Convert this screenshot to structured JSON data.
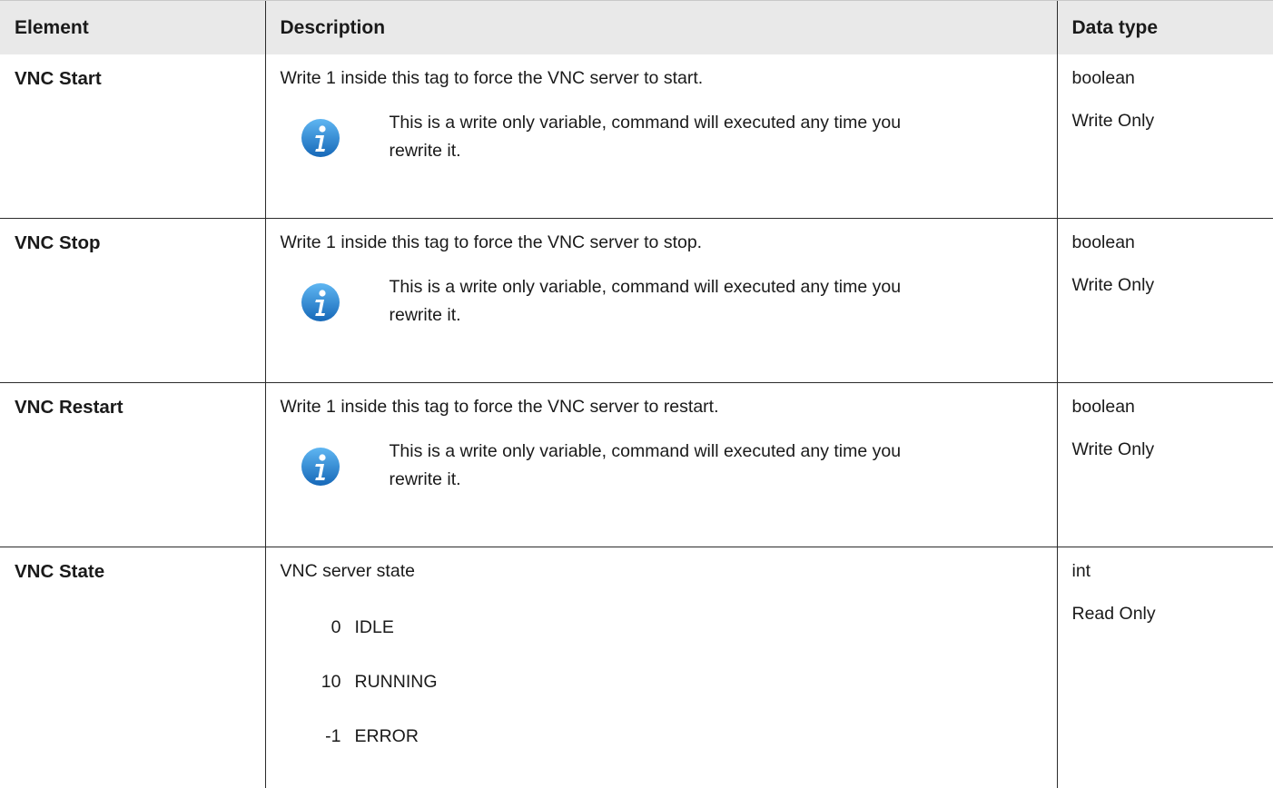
{
  "table": {
    "headers": {
      "element": "Element",
      "description": "Description",
      "data_type": "Data type"
    },
    "rows": [
      {
        "element": "VNC Start",
        "desc": "Write 1 inside this tag to force the VNC server to start.",
        "note": "This is a write only variable, command will executed any time you rewrite it.",
        "type": "boolean",
        "access": "Write Only"
      },
      {
        "element": "VNC Stop",
        "desc": "Write 1 inside this tag to force the VNC server to stop.",
        "note": "This is a write only variable, command will executed any time you rewrite it.",
        "type": "boolean",
        "access": "Write Only"
      },
      {
        "element": "VNC Restart",
        "desc": "Write 1 inside this tag to force the VNC server to restart.",
        "note": "This is a write only variable, command will executed any time you rewrite it.",
        "type": "boolean",
        "access": "Write Only"
      },
      {
        "element": "VNC State",
        "desc": "VNC server state",
        "type": "int",
        "access": "Read Only",
        "states": [
          {
            "code": "0",
            "name": "IDLE"
          },
          {
            "code": "10",
            "name": "RUNNING"
          },
          {
            "code": "-1",
            "name": "ERROR"
          }
        ]
      }
    ]
  },
  "icons": {
    "note_icon": "info-icon",
    "icon_color": "#1f7fd0"
  }
}
